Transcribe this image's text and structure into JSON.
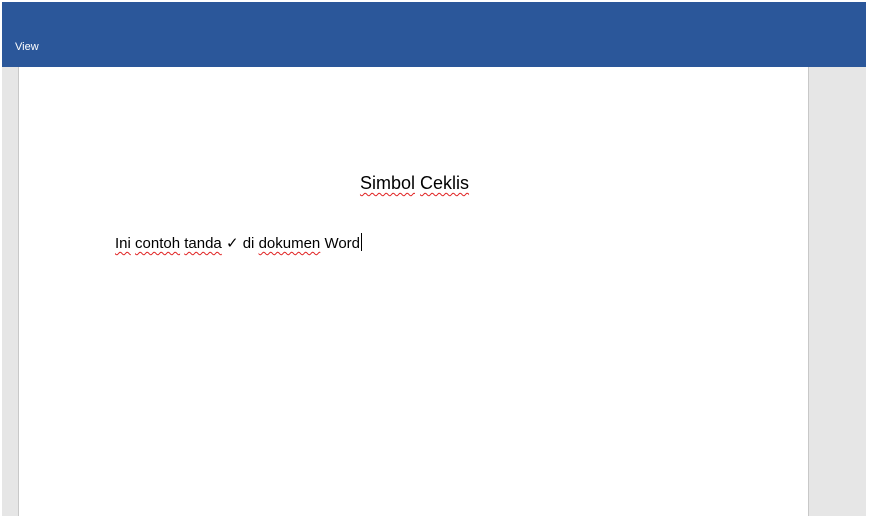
{
  "ribbon": {
    "tabs": [
      {
        "label": "View"
      }
    ]
  },
  "document": {
    "title_words": [
      "Simbol",
      "Ceklis"
    ],
    "body": {
      "w1": "Ini",
      "w2": "contoh",
      "w3": "tanda",
      "check": "✓",
      "w4": "di",
      "w5": "dokumen",
      "w6": "Word"
    }
  },
  "colors": {
    "ribbon": "#2b579a",
    "canvas": "#e6e6e6",
    "spellcheck_underline": "#e02020"
  }
}
